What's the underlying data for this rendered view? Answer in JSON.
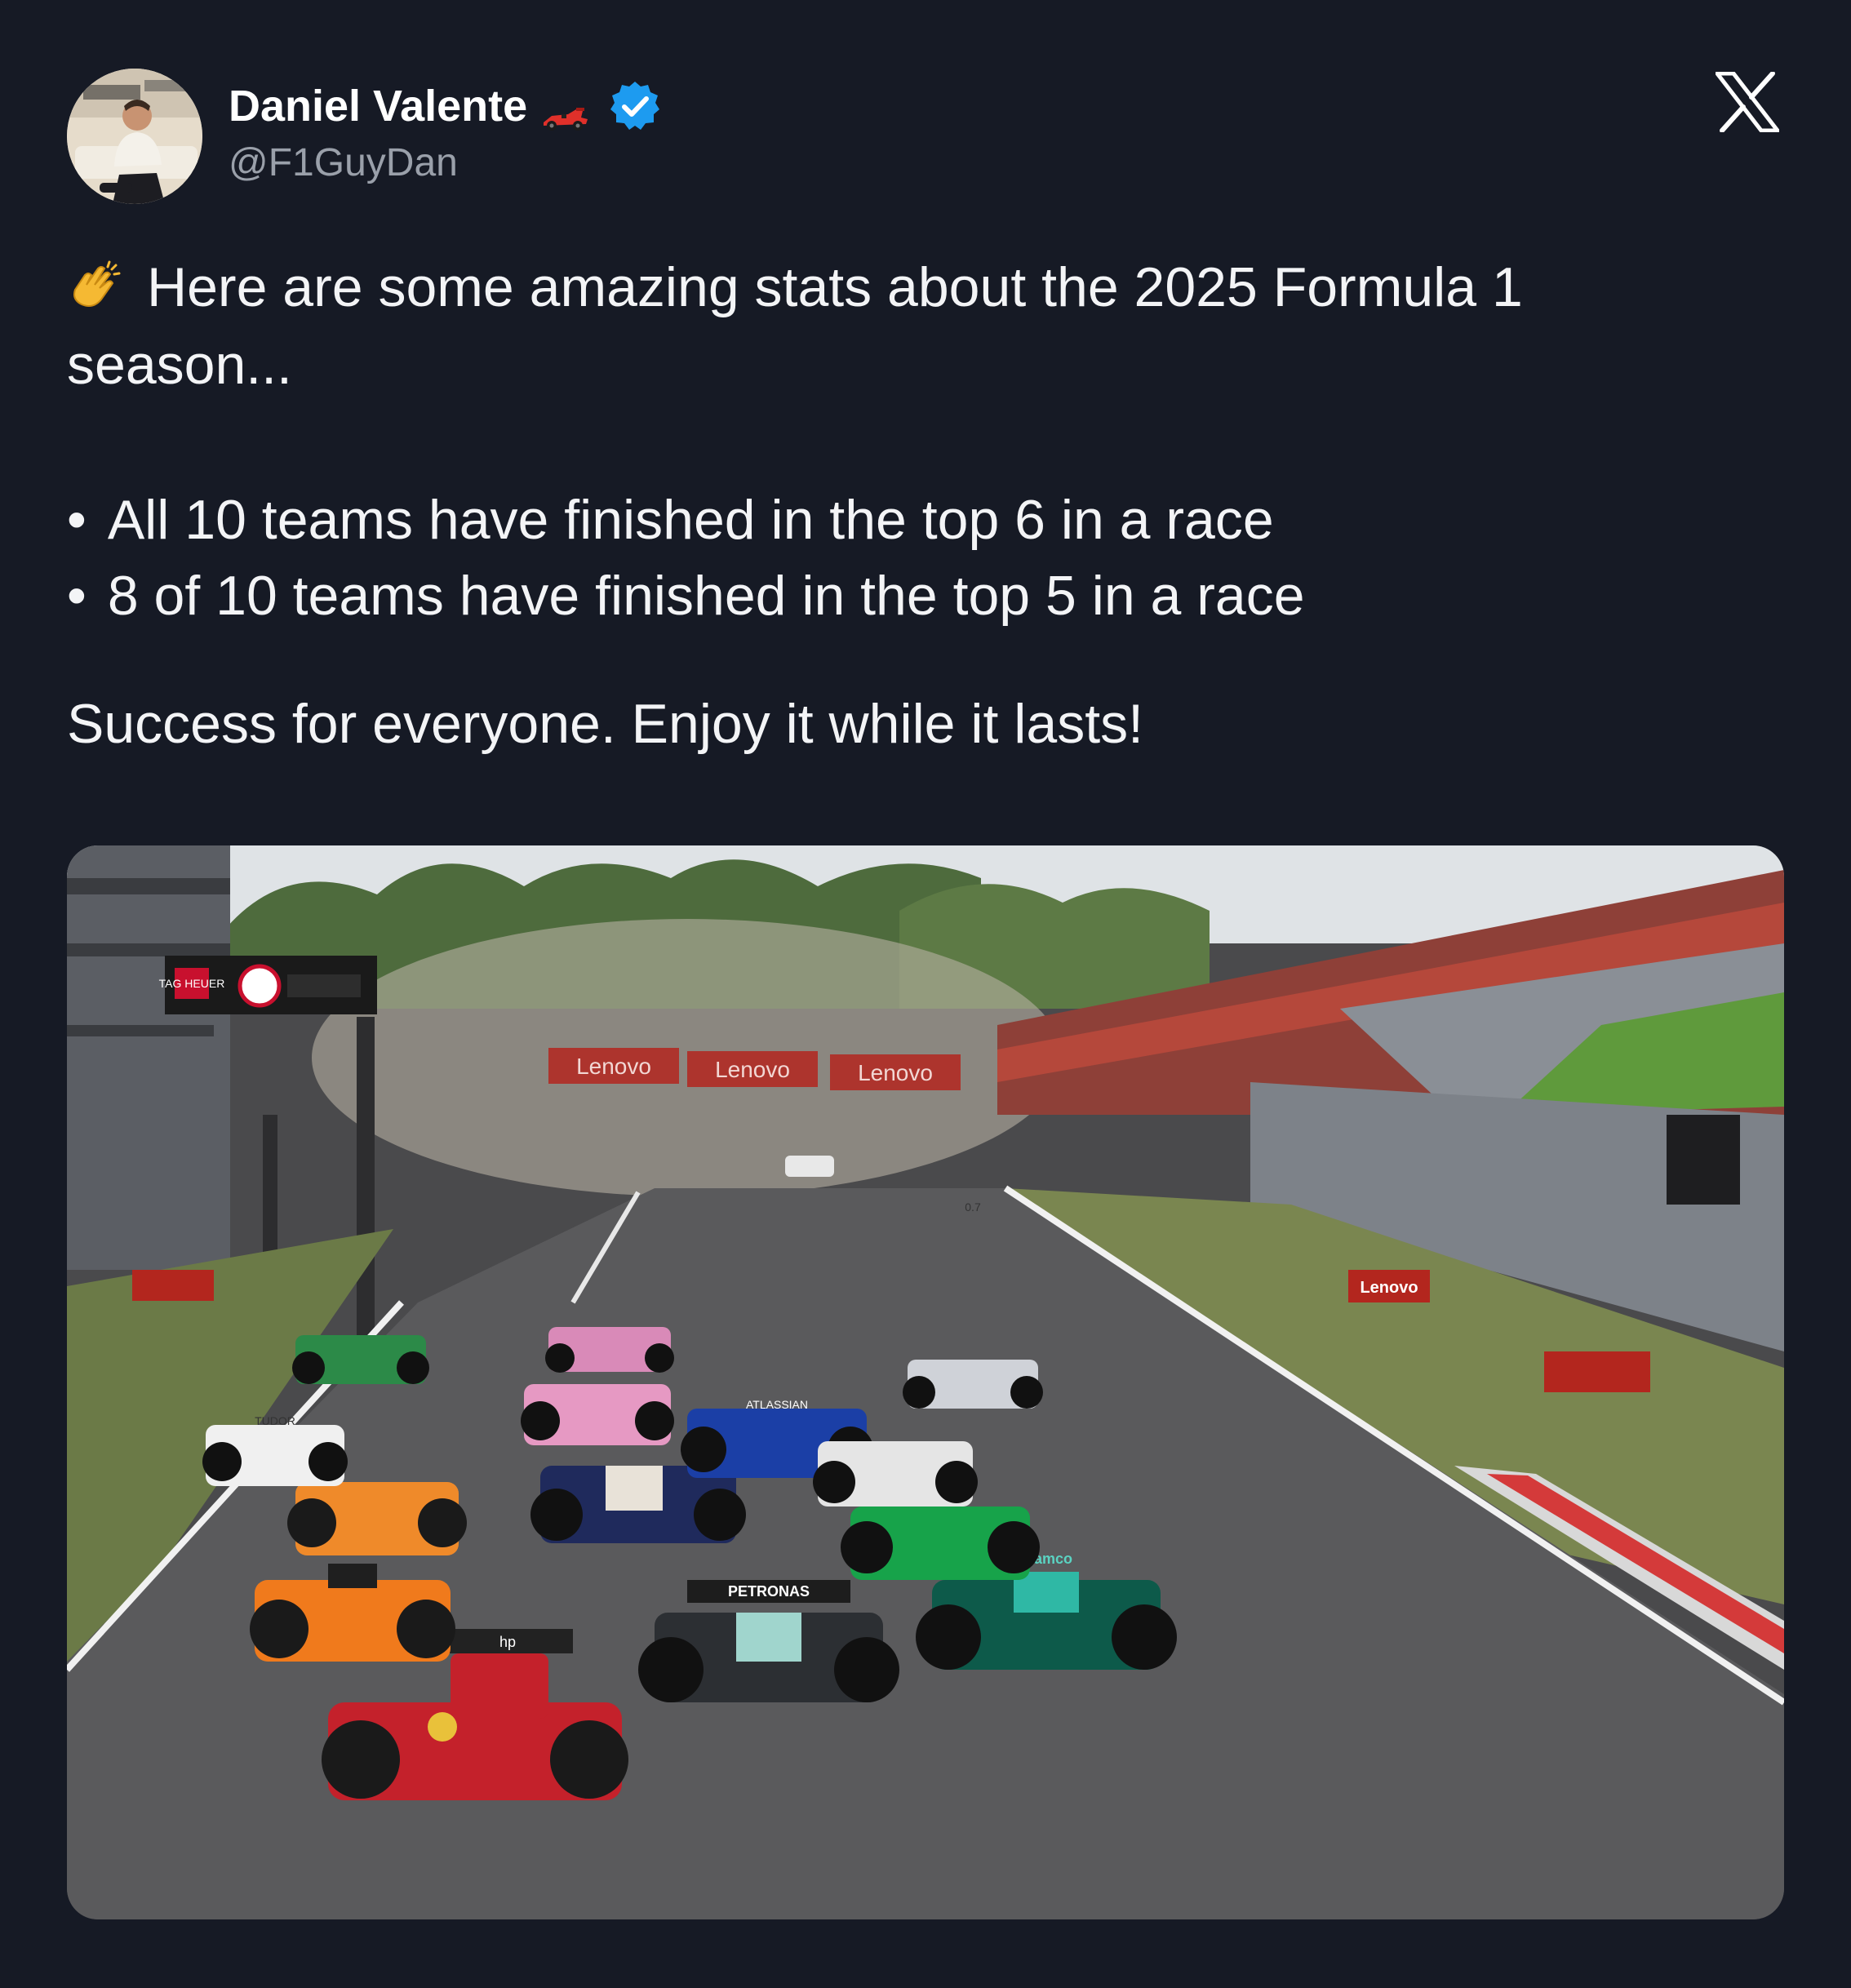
{
  "author": {
    "name": "Daniel Valente",
    "handle": "@F1GuyDan",
    "badge_emoji": "race-car-emoji",
    "verified": true,
    "verified_color": "#1d9bf0"
  },
  "tweet": {
    "intro_emoji": "clapping-hands-emoji",
    "intro_line1": "Here are some amazing stats about the 2025 Formula 1",
    "intro_line2": "season...",
    "bullets": [
      "All 10 teams have finished in the top 6 in a race",
      "8 of 10 teams have finished in the top 5 in a race"
    ],
    "closing": "Success for everyone. Enjoy it while it lasts!"
  },
  "photo": {
    "banner_text": [
      "Lenovo",
      "Lenovo",
      "Lenovo"
    ],
    "side_sign": "Lenovo",
    "timing_brand": "TAG HEUER",
    "car_sponsors": [
      "PETRONAS",
      "ATLASSIAN",
      "TUDOR",
      "hp",
      "aramco"
    ],
    "distance_marker": "0.7"
  },
  "colors": {
    "background": "#161a25",
    "text": "#f3f4f6",
    "secondary_text": "#9aa0aa"
  }
}
